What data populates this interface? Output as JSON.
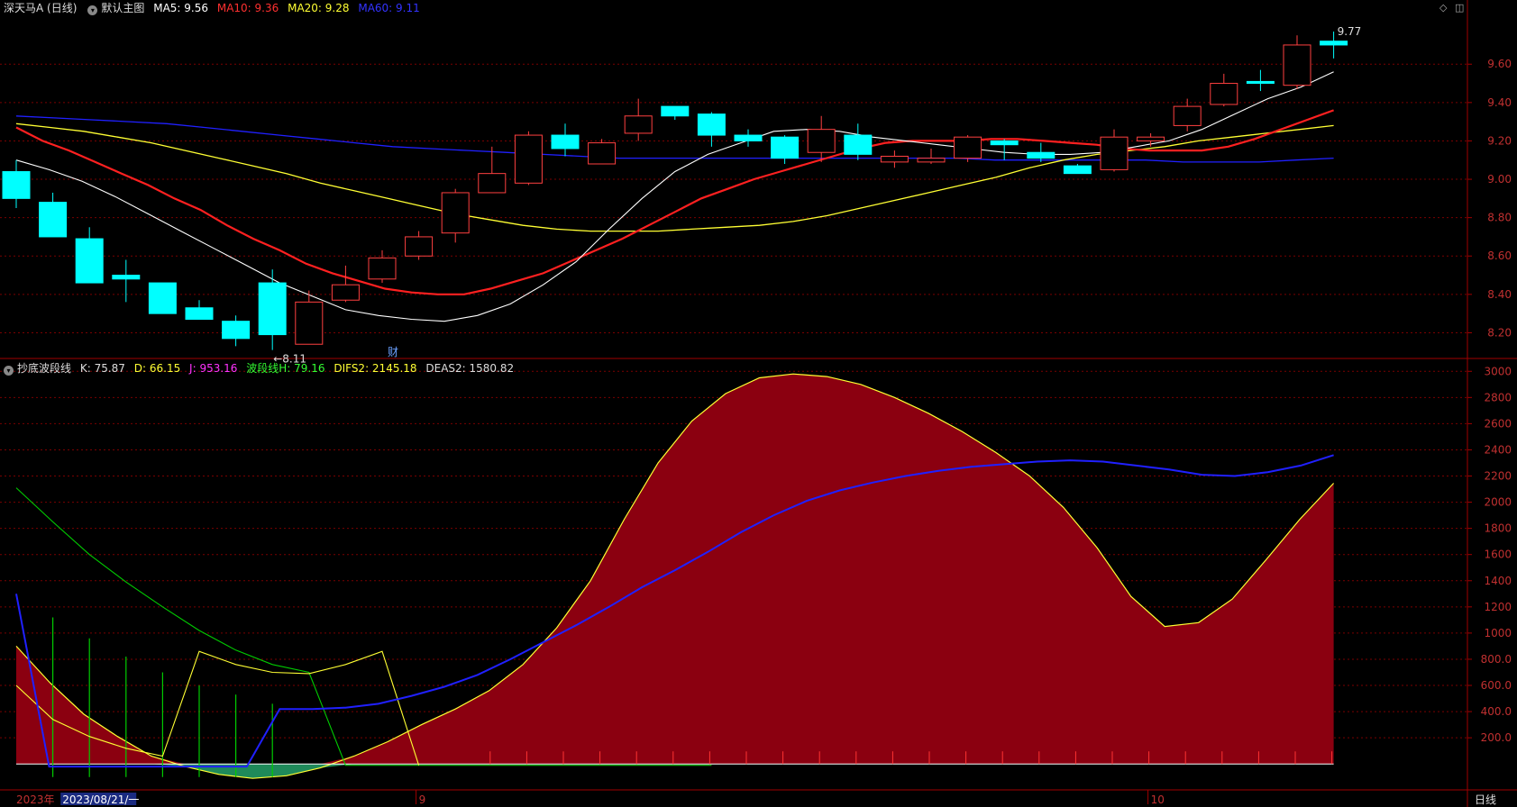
{
  "header": {
    "stock_name": "深天马A (日线)",
    "main_chart_label": "默认主图",
    "ma": [
      {
        "label": "MA5: 9.56",
        "color": "#ffffff"
      },
      {
        "label": "MA10: 9.36",
        "color": "#ff3030"
      },
      {
        "label": "MA20: 9.28",
        "color": "#ffff33"
      },
      {
        "label": "MA60: 9.11",
        "color": "#3333ff"
      }
    ]
  },
  "sub_header": {
    "indicator_name": "抄底波段线",
    "values": [
      {
        "label": "K: 75.87",
        "color": "#dddddd"
      },
      {
        "label": "D: 66.15",
        "color": "#ffff33"
      },
      {
        "label": "J: 953.16",
        "color": "#ff33ff"
      },
      {
        "label": "波段线H: 79.16",
        "color": "#33ff33"
      },
      {
        "label": "DIFS2: 2145.18",
        "color": "#ffff33"
      },
      {
        "label": "DEAS2: 1580.82",
        "color": "#dddddd"
      }
    ]
  },
  "colors": {
    "up": "#ff4040",
    "down": "#00ffff",
    "grid": "#7a0000",
    "axis": "#a00000",
    "ma5": "#ffffff",
    "ma10": "#ff2020",
    "ma20": "#ffff33",
    "ma60": "#2020ff",
    "fill": "#8b0010",
    "green": "#009900"
  },
  "price_axis": {
    "ticks": [
      9.6,
      9.4,
      9.2,
      9.0,
      8.8,
      8.6,
      8.4,
      8.2
    ],
    "min": 8.08,
    "max": 9.85
  },
  "osc_axis": {
    "ticks": [
      3000,
      2800,
      2600,
      2400,
      2200,
      2000,
      1800,
      1600,
      1400,
      1200,
      1000,
      800,
      600,
      400,
      200
    ],
    "min": -150,
    "max": 3050
  },
  "annotations": {
    "low_label": "←8.11",
    "high_label": "9.77",
    "cai_label": "财"
  },
  "date_axis": {
    "labels": [
      {
        "text": "2023年",
        "bar": 0
      },
      {
        "text": "2023/08/21/一",
        "bar": 2
      },
      {
        "text": "9",
        "bar": 11
      },
      {
        "text": "10",
        "bar": 31
      }
    ],
    "period": "日线"
  },
  "chart_data": {
    "type": "candlestick",
    "candles": [
      {
        "o": 9.04,
        "c": 8.9,
        "h": 9.1,
        "l": 8.85
      },
      {
        "o": 8.88,
        "c": 8.7,
        "h": 8.93,
        "l": 8.7
      },
      {
        "o": 8.69,
        "c": 8.46,
        "h": 8.75,
        "l": 8.46
      },
      {
        "o": 8.5,
        "c": 8.48,
        "h": 8.58,
        "l": 8.36
      },
      {
        "o": 8.46,
        "c": 8.3,
        "h": 8.46,
        "l": 8.3
      },
      {
        "o": 8.33,
        "c": 8.27,
        "h": 8.37,
        "l": 8.27
      },
      {
        "o": 8.26,
        "c": 8.17,
        "h": 8.29,
        "l": 8.13
      },
      {
        "o": 8.46,
        "c": 8.19,
        "h": 8.53,
        "l": 8.11
      },
      {
        "o": 8.14,
        "c": 8.36,
        "h": 8.42,
        "l": 8.14
      },
      {
        "o": 8.37,
        "c": 8.45,
        "h": 8.55,
        "l": 8.36
      },
      {
        "o": 8.48,
        "c": 8.59,
        "h": 8.63,
        "l": 8.46
      },
      {
        "o": 8.6,
        "c": 8.7,
        "h": 8.73,
        "l": 8.58
      },
      {
        "o": 8.72,
        "c": 8.93,
        "h": 8.95,
        "l": 8.67
      },
      {
        "o": 8.93,
        "c": 9.03,
        "h": 9.17,
        "l": 8.93
      },
      {
        "o": 8.98,
        "c": 9.23,
        "h": 9.25,
        "l": 8.97
      },
      {
        "o": 9.23,
        "c": 9.16,
        "h": 9.29,
        "l": 9.12
      },
      {
        "o": 9.08,
        "c": 9.19,
        "h": 9.21,
        "l": 9.08
      },
      {
        "o": 9.24,
        "c": 9.33,
        "h": 9.42,
        "l": 9.2
      },
      {
        "o": 9.38,
        "c": 9.33,
        "h": 9.38,
        "l": 9.31
      },
      {
        "o": 9.34,
        "c": 9.23,
        "h": 9.35,
        "l": 9.17
      },
      {
        "o": 9.23,
        "c": 9.2,
        "h": 9.26,
        "l": 9.17
      },
      {
        "o": 9.22,
        "c": 9.11,
        "h": 9.23,
        "l": 9.08
      },
      {
        "o": 9.14,
        "c": 9.26,
        "h": 9.33,
        "l": 9.09
      },
      {
        "o": 9.23,
        "c": 9.13,
        "h": 9.29,
        "l": 9.1
      },
      {
        "o": 9.09,
        "c": 9.12,
        "h": 9.15,
        "l": 9.06
      },
      {
        "o": 9.09,
        "c": 9.11,
        "h": 9.16,
        "l": 9.08
      },
      {
        "o": 9.11,
        "c": 9.22,
        "h": 9.23,
        "l": 9.09
      },
      {
        "o": 9.2,
        "c": 9.18,
        "h": 9.21,
        "l": 9.1
      },
      {
        "o": 9.14,
        "c": 9.11,
        "h": 9.19,
        "l": 9.09
      },
      {
        "o": 9.07,
        "c": 9.03,
        "h": 9.08,
        "l": 9.03
      },
      {
        "o": 9.05,
        "c": 9.22,
        "h": 9.26,
        "l": 9.04
      },
      {
        "o": 9.2,
        "c": 9.22,
        "h": 9.24,
        "l": 9.17
      },
      {
        "o": 9.28,
        "c": 9.38,
        "h": 9.42,
        "l": 9.25
      },
      {
        "o": 9.39,
        "c": 9.5,
        "h": 9.55,
        "l": 9.38
      },
      {
        "o": 9.51,
        "c": 9.5,
        "h": 9.57,
        "l": 9.46
      },
      {
        "o": 9.49,
        "c": 9.7,
        "h": 9.75,
        "l": 9.47
      },
      {
        "o": 9.72,
        "c": 9.7,
        "h": 9.77,
        "l": 9.63
      }
    ],
    "ma5": [
      9.1,
      9.05,
      8.99,
      8.91,
      8.82,
      8.73,
      8.64,
      8.55,
      8.46,
      8.39,
      8.32,
      8.29,
      8.27,
      8.26,
      8.29,
      8.35,
      8.45,
      8.57,
      8.74,
      8.9,
      9.04,
      9.13,
      9.19,
      9.25,
      9.26,
      9.25,
      9.22,
      9.2,
      9.18,
      9.16,
      9.14,
      9.13,
      9.13,
      9.14,
      9.17,
      9.2,
      9.26,
      9.34,
      9.42,
      9.48,
      9.56
    ],
    "ma10": [
      9.27,
      9.2,
      9.15,
      9.09,
      9.03,
      8.97,
      8.9,
      8.84,
      8.76,
      8.69,
      8.63,
      8.56,
      8.51,
      8.47,
      8.43,
      8.41,
      8.4,
      8.4,
      8.43,
      8.47,
      8.51,
      8.57,
      8.63,
      8.69,
      8.76,
      8.83,
      8.9,
      8.95,
      9.0,
      9.04,
      9.08,
      9.12,
      9.16,
      9.19,
      9.2,
      9.2,
      9.2,
      9.21,
      9.21,
      9.2,
      9.19,
      9.18,
      9.16,
      9.15,
      9.15,
      9.15,
      9.17,
      9.21,
      9.26,
      9.31,
      9.36
    ],
    "ma20": [
      9.29,
      9.27,
      9.25,
      9.22,
      9.19,
      9.15,
      9.11,
      9.07,
      9.03,
      8.98,
      8.94,
      8.9,
      8.86,
      8.82,
      8.79,
      8.76,
      8.74,
      8.73,
      8.73,
      8.73,
      8.74,
      8.75,
      8.76,
      8.78,
      8.81,
      8.85,
      8.89,
      8.93,
      8.97,
      9.01,
      9.06,
      9.1,
      9.13,
      9.15,
      9.17,
      9.2,
      9.22,
      9.24,
      9.26,
      9.28
    ],
    "ma60": [
      9.33,
      9.32,
      9.31,
      9.3,
      9.29,
      9.27,
      9.25,
      9.23,
      9.21,
      9.19,
      9.17,
      9.16,
      9.15,
      9.14,
      9.13,
      9.12,
      9.11,
      9.11,
      9.11,
      9.11,
      9.11,
      9.11,
      9.11,
      9.11,
      9.11,
      9.11,
      9.1,
      9.1,
      9.1,
      9.1,
      9.1,
      9.09,
      9.09,
      9.09,
      9.1,
      9.11
    ],
    "osc_area": [
      900,
      620,
      380,
      210,
      60,
      -20,
      -80,
      -110,
      -90,
      -30,
      60,
      170,
      300,
      420,
      560,
      760,
      1040,
      1400,
      1870,
      2300,
      2620,
      2830,
      2950,
      2980,
      2960,
      2900,
      2800,
      2680,
      2540,
      2380,
      2200,
      1960,
      1650,
      1280,
      1050,
      1080,
      1260,
      1560,
      1870,
      2145
    ],
    "osc_blue": [
      1300,
      -20,
      -20,
      -20,
      -20,
      -20,
      -20,
      -20,
      420,
      420,
      430,
      460,
      520,
      590,
      680,
      800,
      930,
      1060,
      1200,
      1350,
      1480,
      1620,
      1770,
      1900,
      2010,
      2090,
      2150,
      2200,
      2240,
      2270,
      2290,
      2310,
      2320,
      2310,
      2280,
      2250,
      2210,
      2200,
      2230,
      2280,
      2360
    ],
    "osc_green": [
      2110,
      1850,
      1600,
      1390,
      1200,
      1020,
      870,
      760,
      700,
      -10,
      -10,
      -10,
      -10,
      -10,
      -10,
      -10,
      -10,
      -10,
      -10,
      -10
    ],
    "osc_yellow2": [
      600,
      340,
      210,
      120,
      60,
      860,
      760,
      700,
      690,
      760,
      860,
      -10
    ],
    "spikes": [
      {
        "bar": 1,
        "v": 1120
      },
      {
        "bar": 2,
        "v": 960
      },
      {
        "bar": 3,
        "v": 820
      },
      {
        "bar": 4,
        "v": 700
      },
      {
        "bar": 5,
        "v": 600
      },
      {
        "bar": 6,
        "v": 530
      },
      {
        "bar": 7,
        "v": 460
      }
    ],
    "small_marks": [
      13,
      14,
      15,
      16,
      17,
      18,
      19,
      20,
      21,
      22,
      23,
      24,
      25,
      26,
      27,
      28,
      29,
      30,
      31,
      32,
      33,
      34,
      35,
      36
    ]
  }
}
